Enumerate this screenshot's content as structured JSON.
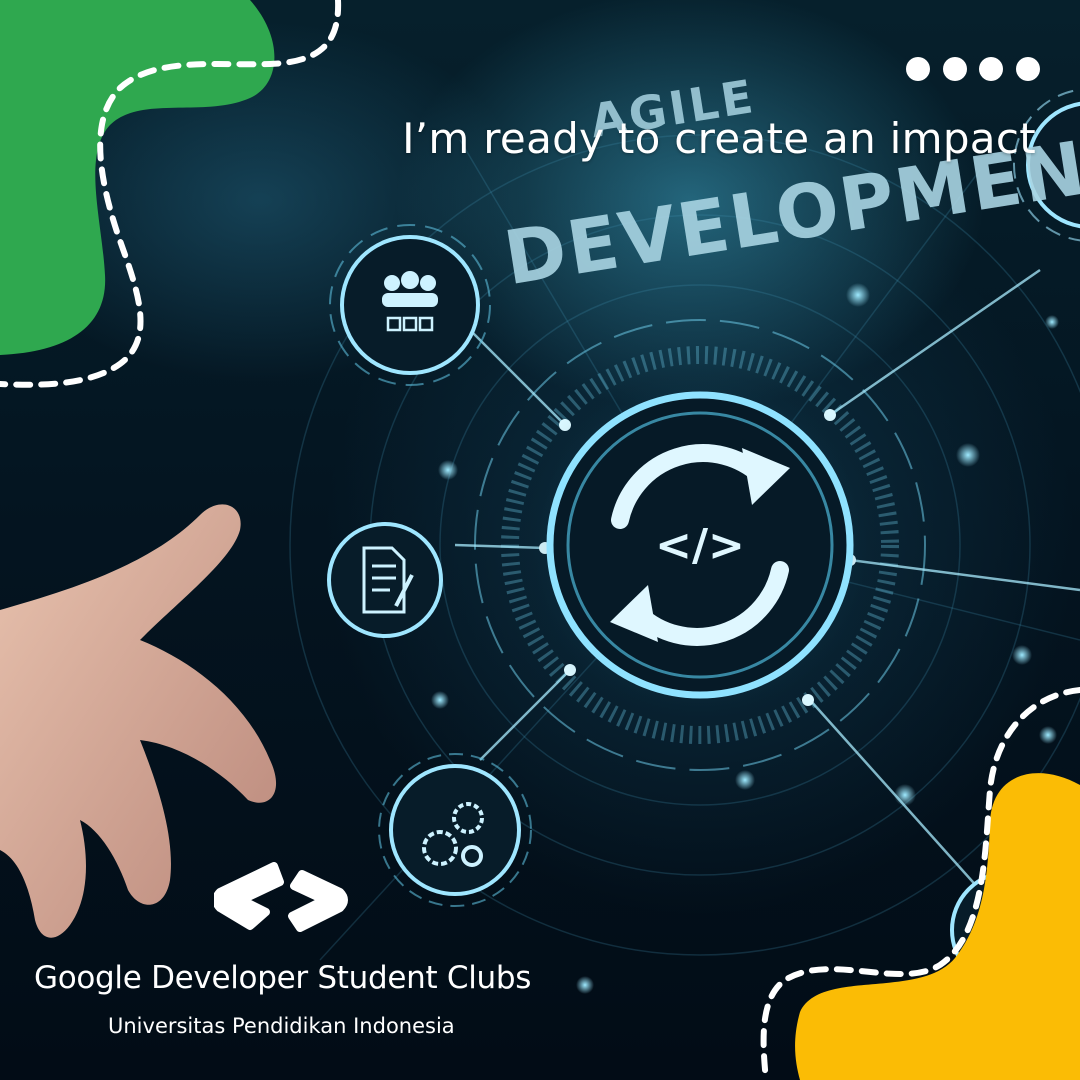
{
  "headline": "I’m ready to create an impact",
  "graphic_text": {
    "line1": "AGILE",
    "line2": "DEVELOPMENT",
    "code_symbol": "</>"
  },
  "brand": {
    "name": "Google Developer Student Clubs",
    "institution": "Universitas Pendidikan Indonesia"
  },
  "colors": {
    "green_blob": "#2fa84f",
    "yellow_blob": "#fbbc05",
    "glow": "#5fd6ff",
    "text": "#ffffff"
  },
  "icons": [
    "menu-dots-icon",
    "team-icon",
    "document-icon",
    "gears-icon",
    "sync-code-icon",
    "gdsc-logo-icon"
  ]
}
